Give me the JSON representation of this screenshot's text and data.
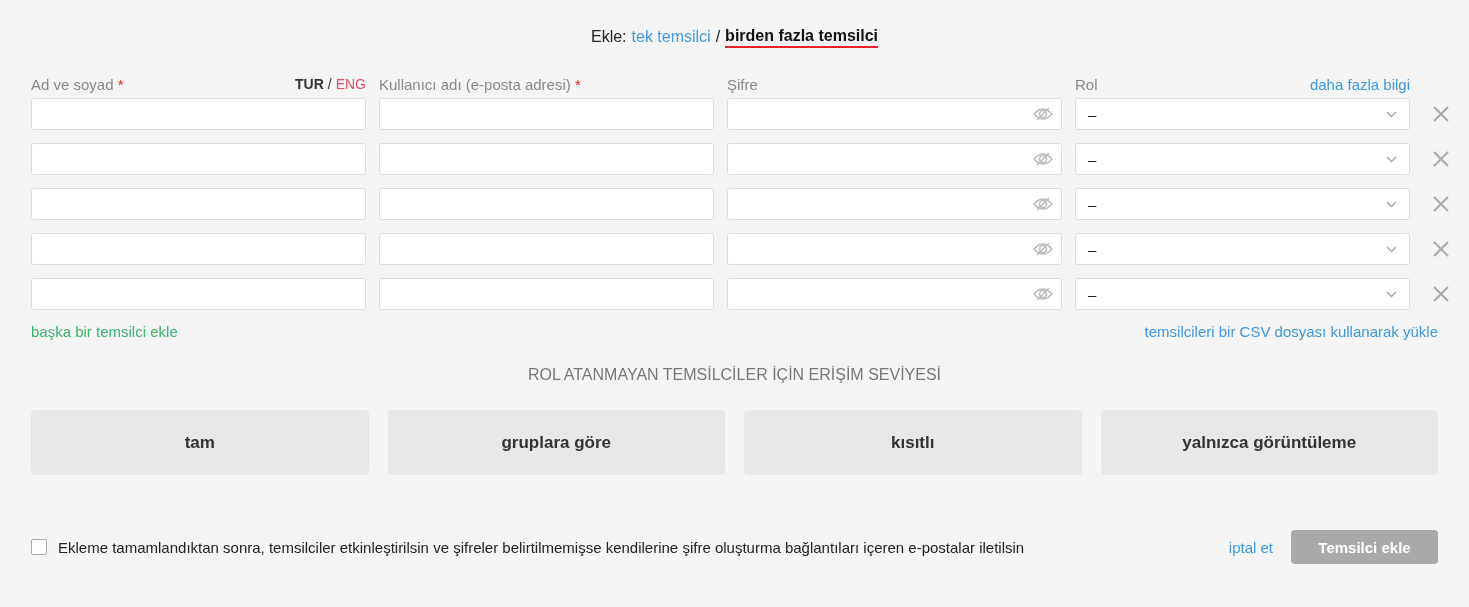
{
  "mode": {
    "prefix": "Ekle:",
    "separator": "/",
    "options": [
      {
        "label": "tek temsilci",
        "selected": false
      },
      {
        "label": "birden fazla temsilci",
        "selected": true
      }
    ]
  },
  "columns": {
    "name": {
      "label": "Ad ve soyad",
      "required_mark": "*",
      "languages": [
        {
          "label": "TUR",
          "selected": true
        },
        {
          "label": "ENG",
          "selected": false
        }
      ],
      "language_separator": "/"
    },
    "email": {
      "label": "Kullanıcı adı (e-posta adresi)",
      "required_mark": "*"
    },
    "password": {
      "label": "Şifre"
    },
    "role": {
      "label": "Rol",
      "link": "daha fazla bilgi"
    }
  },
  "rows": [
    {
      "role": "–"
    },
    {
      "role": "–"
    },
    {
      "role": "–"
    },
    {
      "role": "–"
    },
    {
      "role": "–"
    }
  ],
  "add_link": "başka bir temsilci ekle",
  "csv_link": "temsilcileri bir CSV dosyası kullanarak yükle",
  "access": {
    "title": "ROL ATANMAYAN TEMSİLCİLER İÇİN ERİŞİM SEVİYESİ",
    "options": [
      {
        "label": "tam",
        "selected": false
      },
      {
        "label": "gruplara göre",
        "selected": false
      },
      {
        "label": "kısıtlı",
        "selected": false
      },
      {
        "label": "yalnızca görüntüleme",
        "selected": false
      }
    ]
  },
  "notify": {
    "label": "Ekleme tamamlandıktan sonra, temsilciler etkinleştirilsin ve şifreler belirtilmemişse kendilerine şifre oluşturma bağlantıları içeren e-postalar iletilsin",
    "checked": false
  },
  "cancel": "iptal et",
  "submit": {
    "label": "Temsilci ekle",
    "disabled": true
  }
}
